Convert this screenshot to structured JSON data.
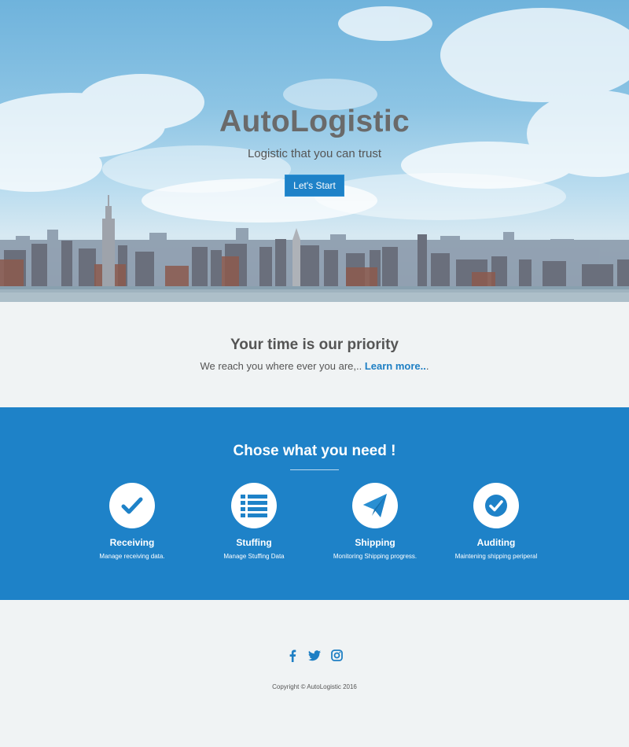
{
  "hero": {
    "title": "AutoLogistic",
    "tagline": "Logistic that you can trust",
    "button_label": "Let's Start"
  },
  "priority": {
    "title": "Your time is our priority",
    "text": "We reach you where ever you are,.. ",
    "link_label": "Learn more..",
    "trailing": "."
  },
  "services": {
    "title": "Chose what you need !",
    "items": [
      {
        "name": "Receiving",
        "description": "Manage receiving data.",
        "icon": "check-icon"
      },
      {
        "name": "Stuffing",
        "description": "Manage Stuffing Data",
        "icon": "list-icon"
      },
      {
        "name": "Shipping",
        "description": "Monitoring Shipping progress.",
        "icon": "paper-plane-icon"
      },
      {
        "name": "Auditing",
        "description": "Maintening shipping periperal",
        "icon": "check-circle-icon"
      }
    ]
  },
  "footer": {
    "socials": [
      "facebook-icon",
      "twitter-icon",
      "instagram-icon"
    ],
    "copyright": "Copyright © AutoLogistic 2016"
  },
  "colors": {
    "accent": "#1e82c8",
    "background": "#f0f3f4",
    "text": "#555555"
  }
}
